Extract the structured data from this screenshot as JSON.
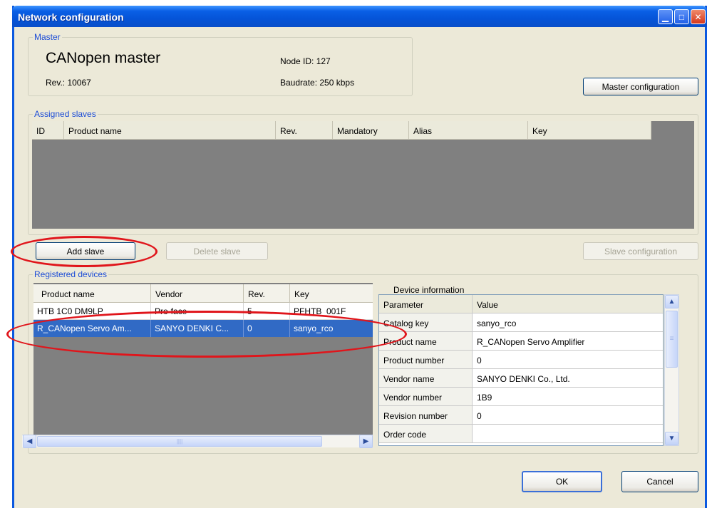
{
  "window": {
    "title": "Network configuration"
  },
  "master": {
    "group_label": "Master",
    "name": "CANopen master",
    "rev_label": "Rev.: 10067",
    "node_label": "Node ID: 127",
    "baud_label": "Baudrate: 250 kbps",
    "config_button": "Master configuration"
  },
  "assigned": {
    "group_label": "Assigned slaves",
    "columns": [
      "ID",
      "Product name",
      "Rev.",
      "Mandatory",
      "Alias",
      "Key"
    ],
    "add_button": "Add slave",
    "delete_button": "Delete slave",
    "slave_config_button": "Slave configuration"
  },
  "registered": {
    "group_label": "Registered devices",
    "columns": [
      "Product name",
      "Vendor",
      "Rev.",
      "Key"
    ],
    "rows": [
      [
        "HTB 1C0 DM9LP",
        "Pro-face",
        "5",
        "PFHTB_001F"
      ],
      [
        "R_CANopen Servo Am...",
        "SANYO DENKI C...",
        "0",
        "sanyo_rco"
      ]
    ],
    "selected_row": 1,
    "hscroll_grip": "||||"
  },
  "device_info": {
    "label": "Device information",
    "columns": [
      "Parameter",
      "Value"
    ],
    "rows": [
      [
        "Catalog key",
        "sanyo_rco"
      ],
      [
        "Product name",
        "R_CANopen Servo Amplifier"
      ],
      [
        "Product number",
        "0"
      ],
      [
        "Vendor name",
        "SANYO DENKI Co., Ltd."
      ],
      [
        "Vendor number",
        "1B9"
      ],
      [
        "Revision number",
        "0"
      ],
      [
        "Order code",
        ""
      ]
    ],
    "vscroll_grip": "≡"
  },
  "footer": {
    "ok": "OK",
    "cancel": "Cancel"
  },
  "titlebar_buttons": {
    "minimize": "▁",
    "maximize": "□",
    "close": "✕"
  },
  "colors": {
    "selection": "#316ac5",
    "titlebar": "#0a5fe6",
    "annotation": "#e0151b"
  }
}
